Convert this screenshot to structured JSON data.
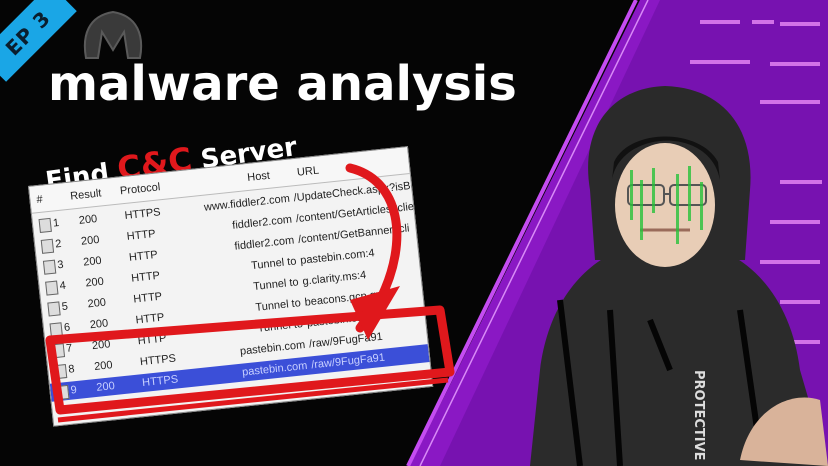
{
  "badge": {
    "label": "EP 3"
  },
  "title": {
    "text": "malware analysis"
  },
  "subtitle": {
    "prefix": "Find ",
    "highlight": "C&C",
    "suffix": " Server"
  },
  "table": {
    "headers": {
      "num": "#",
      "result": "Result",
      "protocol": "Protocol",
      "host": "Host",
      "url": "URL"
    },
    "rows": [
      {
        "num": "1",
        "result": "200",
        "protocol": "HTTPS",
        "host": "www.fiddler2.com",
        "url": "/UpdateCheck.aspx?isBet"
      },
      {
        "num": "2",
        "result": "200",
        "protocol": "HTTP",
        "host": "fiddler2.com",
        "url": "/content/GetArticles?clie"
      },
      {
        "num": "3",
        "result": "200",
        "protocol": "HTTP",
        "host": "fiddler2.com",
        "url": "/content/GetBanner?cli"
      },
      {
        "num": "4",
        "result": "200",
        "protocol": "HTTP",
        "host": "Tunnel to",
        "url": "pastebin.com:4"
      },
      {
        "num": "5",
        "result": "200",
        "protocol": "HTTP",
        "host": "Tunnel to",
        "url": "g.clarity.ms:4"
      },
      {
        "num": "6",
        "result": "200",
        "protocol": "HTTP",
        "host": "Tunnel to",
        "url": "beacons.gcp.gvt2"
      },
      {
        "num": "7",
        "result": "200",
        "protocol": "HTTP",
        "host": "Tunnel to",
        "url": "pastebin.com:443"
      },
      {
        "num": "8",
        "result": "200",
        "protocol": "HTTPS",
        "host": "pastebin.com",
        "url": "/raw/9FugFa91"
      },
      {
        "num": "9",
        "result": "200",
        "protocol": "HTTPS",
        "host": "pastebin.com",
        "url": "/raw/9FugFa91"
      }
    ]
  },
  "shirt": {
    "text": "PROTECTIVE"
  },
  "colors": {
    "accent_purple": "#9b1fd0",
    "highlight_red": "#e0181c",
    "badge_blue": "#1aa6e6",
    "select_blue": "#3b4fd8"
  }
}
